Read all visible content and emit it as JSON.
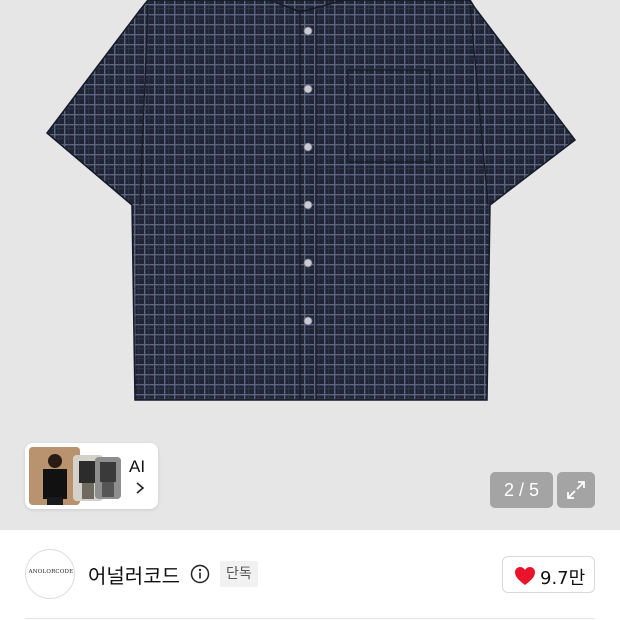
{
  "product_image": {
    "alt_semantic": "short-sleeve-checked-shirt",
    "background_color": "#e6e6e6",
    "shirt_color": "#1e2433",
    "check_color": "#5d6680"
  },
  "ai_style": {
    "label": "AI",
    "icon": "chevron-right-icon"
  },
  "gallery": {
    "pager_text": "2 / 5",
    "expand_icon": "expand-icon"
  },
  "seller": {
    "logo_text": "ANOLORCODE",
    "name": "어널러코드",
    "info_icon": "info-icon",
    "badge": "단독"
  },
  "like": {
    "icon": "heart-icon",
    "heart_color": "#e8142c",
    "count": "9.7만"
  }
}
